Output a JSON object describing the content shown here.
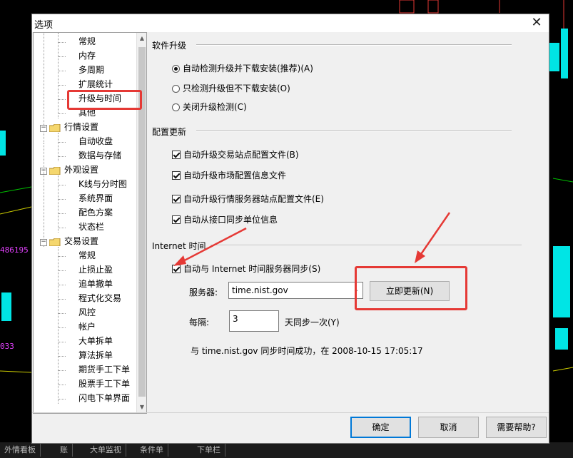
{
  "background": {
    "ticker_left": "486195",
    "ticker_left2": "033",
    "taskbar_tabs": [
      "外情看板",
      "账",
      "大单监视",
      "条件单",
      "下单栏"
    ]
  },
  "dialog": {
    "title": "选项",
    "close_label": "✕"
  },
  "tree": {
    "items": [
      {
        "label": "常规"
      },
      {
        "label": "内存"
      },
      {
        "label": "多周期"
      },
      {
        "label": "扩展统计"
      },
      {
        "label": "升级与时间"
      },
      {
        "label": "其他"
      },
      {
        "label": "行情设置"
      },
      {
        "label": "自动收盘"
      },
      {
        "label": "数据与存储"
      },
      {
        "label": "外观设置"
      },
      {
        "label": "K线与分时图"
      },
      {
        "label": "系统界面"
      },
      {
        "label": "配色方案"
      },
      {
        "label": "状态栏"
      },
      {
        "label": "交易设置"
      },
      {
        "label": "常规"
      },
      {
        "label": "止损止盈"
      },
      {
        "label": "追单撤单"
      },
      {
        "label": "程式化交易"
      },
      {
        "label": "风控"
      },
      {
        "label": "帐户"
      },
      {
        "label": "大单拆单"
      },
      {
        "label": "算法拆单"
      },
      {
        "label": "期货手工下单"
      },
      {
        "label": "股票手工下单"
      },
      {
        "label": "闪电下单界面"
      }
    ]
  },
  "upgrade": {
    "title": "软件升级",
    "options": [
      {
        "label": "自动检测升级并下载安装(推荐)(A)",
        "selected": true
      },
      {
        "label": "只检测升级但不下载安装(O)",
        "selected": false
      },
      {
        "label": "关闭升级检测(C)",
        "selected": false
      }
    ]
  },
  "config": {
    "title": "配置更新",
    "options": [
      {
        "label": "自动升级交易站点配置文件(B)",
        "checked": true
      },
      {
        "label": "自动升级市场配置信息文件",
        "checked": true
      },
      {
        "label": "自动升级行情服务器站点配置文件(E)",
        "checked": true
      },
      {
        "label": "自动从接口同步单位信息",
        "checked": true
      }
    ]
  },
  "internet_time": {
    "title": "Internet 时间",
    "sync_label": "自动与 Internet 时间服务器同步(S)",
    "sync_checked": true,
    "server_label": "服务器:",
    "server_value": "time.nist.gov",
    "update_button": "立即更新(N)",
    "interval_label": "每隔:",
    "interval_value": "3",
    "interval_suffix": "天同步一次(Y)",
    "status": "与 time.nist.gov 同步时间成功，在 2008-10-15 17:05:17"
  },
  "footer": {
    "ok": "确定",
    "cancel": "取消",
    "help": "需要帮助?"
  },
  "colors": {
    "annotation": "#e53935",
    "accent": "#0078d7"
  }
}
